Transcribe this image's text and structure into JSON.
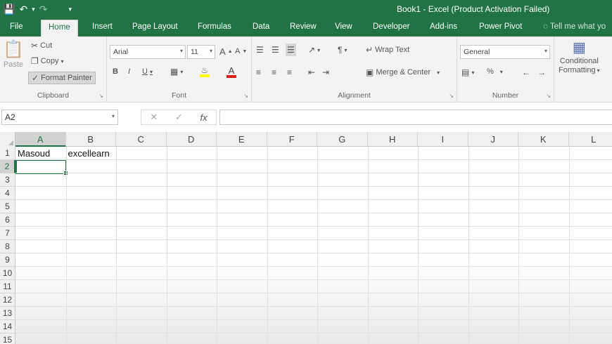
{
  "window": {
    "title": "Book1 - Excel (Product Activation Failed)"
  },
  "qat": {
    "save_icon": "save-icon",
    "undo_icon": "undo-icon",
    "redo_icon": "redo-icon",
    "customize_icon": "customize-qat-icon"
  },
  "tabs": [
    {
      "label": "File"
    },
    {
      "label": "Home"
    },
    {
      "label": "Insert"
    },
    {
      "label": "Page Layout"
    },
    {
      "label": "Formulas"
    },
    {
      "label": "Data"
    },
    {
      "label": "Review"
    },
    {
      "label": "View"
    },
    {
      "label": "Developer"
    },
    {
      "label": "Add-ins"
    },
    {
      "label": "Power Pivot"
    }
  ],
  "tell_me": "Tell me what yo",
  "ribbon": {
    "clipboard": {
      "paste": "Paste",
      "cut": "Cut",
      "copy": "Copy",
      "format_painter": "Format Painter",
      "label": "Clipboard"
    },
    "font": {
      "name": "Arial",
      "size": "11",
      "label": "Font",
      "bold": "B",
      "italic": "I",
      "underline": "U",
      "grow": "A",
      "shrink": "A",
      "font_color": "A"
    },
    "alignment": {
      "wrap_text": "Wrap Text",
      "merge_center": "Merge & Center",
      "label": "Alignment"
    },
    "number": {
      "format": "General",
      "percent": "%",
      "label": "Number"
    },
    "styles": {
      "conditional_line1": "Conditional",
      "conditional_line2": "Formatting"
    }
  },
  "formula_bar": {
    "name_box": "A2",
    "cancel": "✕",
    "enter": "✓",
    "fx": "fx",
    "value": ""
  },
  "sheet": {
    "columns": [
      "A",
      "B",
      "C",
      "D",
      "E",
      "F",
      "G",
      "H",
      "I",
      "J",
      "K",
      "L"
    ],
    "rows": [
      "1",
      "2",
      "3",
      "4",
      "5",
      "6",
      "7",
      "8",
      "9",
      "10",
      "11",
      "12",
      "13",
      "14",
      "15"
    ],
    "cells": {
      "A1": "Masoud",
      "B1": "excellearn"
    },
    "active_cell": "A2",
    "accent": "#217346"
  }
}
